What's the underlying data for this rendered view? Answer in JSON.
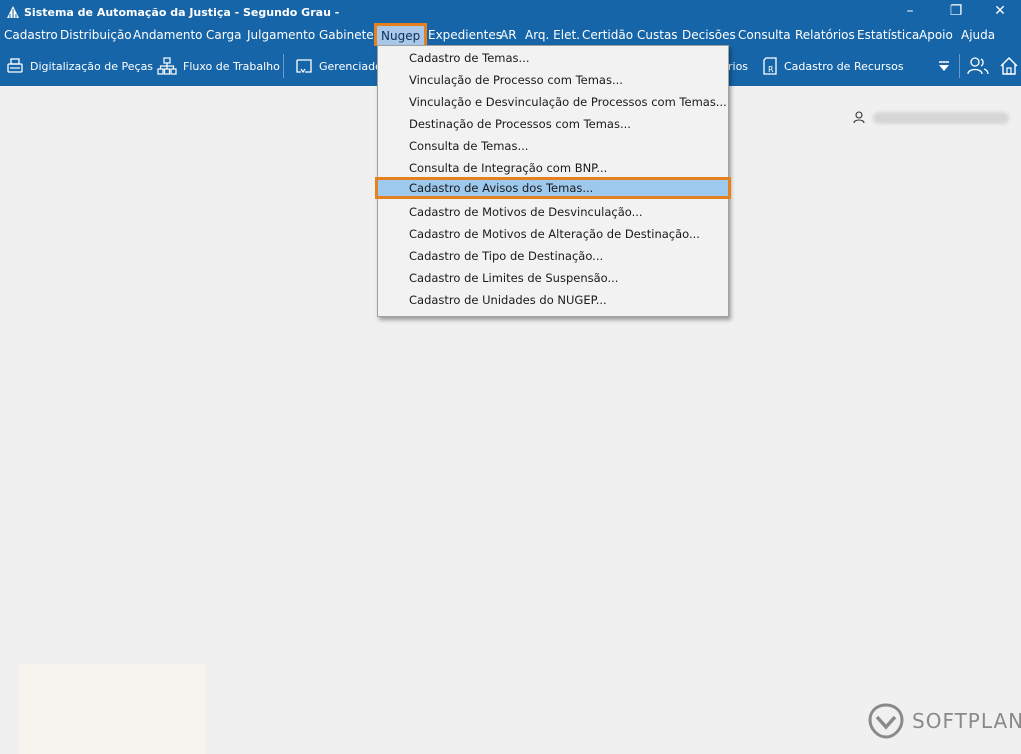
{
  "window": {
    "title": "Sistema de Automação da Justiça - Segundo Grau -",
    "controls": {
      "minimize": "–",
      "maximize": "❐",
      "close": "✕"
    }
  },
  "menubar": {
    "items": [
      "Cadastro",
      "Distribuição",
      "Andamento",
      "Carga",
      "Julgamento",
      "Gabinetes",
      "Nugep",
      "Expedientes",
      "AR",
      "Arq. Elet.",
      "Certidão",
      "Custas",
      "Decisões",
      "Consulta",
      "Relatórios",
      "Estatística",
      "Apoio",
      "Ajuda"
    ],
    "active": "Nugep"
  },
  "toolbar": {
    "digitalizacao": "Digitalização de Peças",
    "fluxo": "Fluxo de Trabalho",
    "gerenciado": "Gerenciado",
    "rios": "rios",
    "recursos": "Cadastro de Recursos"
  },
  "dropdown": {
    "items": [
      "Cadastro de Temas...",
      "Vinculação de Processo com Temas...",
      "Vinculação e Desvinculação de Processos com Temas...",
      "Destinação de Processos com Temas...",
      "Consulta de Temas...",
      "Consulta de Integração com BNP...",
      "Cadastro de Avisos dos Temas...",
      "Cadastro de Motivos de Desvinculação...",
      "Cadastro de Motivos de Alteração de Destinação...",
      "Cadastro de Tipo de Destinação...",
      "Cadastro de Limites de Suspensão...",
      "Cadastro de Unidades do NUGEP..."
    ],
    "highlighted": "Cadastro de Avisos dos Temas..."
  },
  "branding": {
    "logo_text": "SOFTPLAN"
  },
  "colors": {
    "bar_blue": "#1665a8",
    "highlight_orange": "#e5821f",
    "selection_blue": "#9ec9ef"
  }
}
